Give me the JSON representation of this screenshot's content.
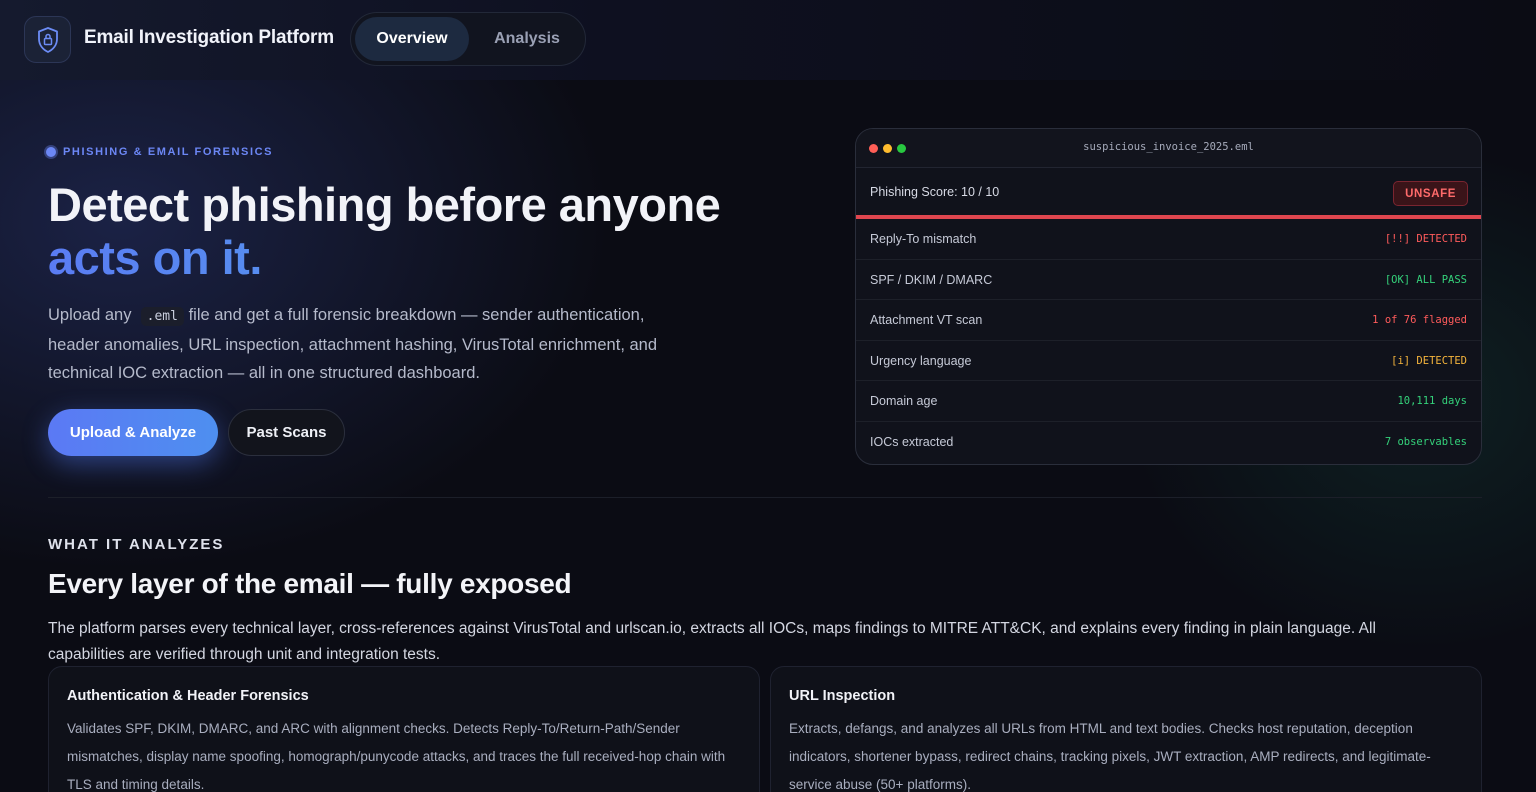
{
  "app": {
    "title": "Email Investigation Platform",
    "logo_icon": "shield-lock-icon"
  },
  "nav": {
    "tabs": [
      {
        "label": "Overview",
        "active": true
      },
      {
        "label": "Analysis",
        "active": false
      }
    ]
  },
  "hero": {
    "eyebrow": "PHISHING & EMAIL FORENSICS",
    "title_line1": "Detect phishing before anyone",
    "title_line2": "acts on it.",
    "desc_before": "Upload any",
    "desc_code": ".eml",
    "desc_after": "file and get a full forensic breakdown — sender authentication, header anomalies, URL inspection, attachment hashing, VirusTotal enrichment, and technical IOC extraction — all in one structured dashboard.",
    "primary_button": "Upload & Analyze",
    "secondary_button": "Past Scans"
  },
  "report": {
    "filename": "suspicious_invoice_2025.eml",
    "score_label": "Phishing Score: 10 / 10",
    "verdict": "UNSAFE",
    "rows": [
      {
        "label": "Reply-To mismatch",
        "value": "[!!] DETECTED",
        "color": "#ff5b5b"
      },
      {
        "label": "SPF / DKIM / DMARC",
        "value": "[OK] ALL PASS",
        "color": "#34d17a"
      },
      {
        "label": "Attachment VT scan",
        "value": "1 of 76 flagged",
        "color": "#ff5b5b"
      },
      {
        "label": "Urgency language",
        "value": "[i] DETECTED",
        "color": "#f5b43c"
      },
      {
        "label": "Domain age",
        "value": "10,111 days",
        "color": "#34d17a"
      },
      {
        "label": "IOCs extracted",
        "value": "7 observables",
        "color": "#34d17a"
      }
    ]
  },
  "analyzes": {
    "eyebrow": "WHAT IT ANALYZES",
    "title": "Every layer of the email — fully exposed",
    "desc": "The platform parses every technical layer, cross-references against VirusTotal and urlscan.io, extracts all IOCs, maps findings to MITRE ATT&CK, and explains every finding in plain language. All capabilities are verified through unit and integration tests.",
    "cards": [
      {
        "title": "Authentication & Header Forensics",
        "desc": "Validates SPF, DKIM, DMARC, and ARC with alignment checks. Detects Reply-To/Return-Path/Sender mismatches, display name spoofing, homograph/punycode attacks, and traces the full received-hop chain with TLS and timing details."
      },
      {
        "title": "URL Inspection",
        "desc": "Extracts, defangs, and analyzes all URLs from HTML and text bodies. Checks host reputation, deception indicators, shortener bypass, redirect chains, tracking pixels, JWT extraction, AMP redirects, and legitimate-service abuse (50+ platforms)."
      }
    ]
  },
  "colors": {
    "accent": "#5b79f4",
    "danger": "#e0464f",
    "ok": "#34d17a",
    "warn": "#f5b43c"
  }
}
